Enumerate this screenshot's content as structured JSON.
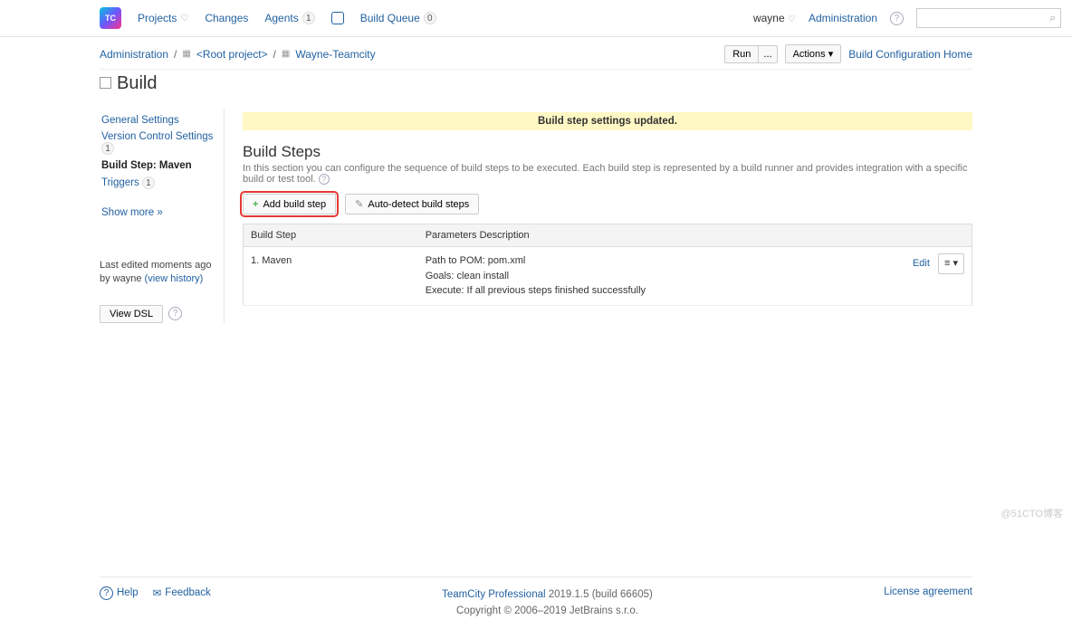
{
  "topnav": {
    "projects": "Projects",
    "changes": "Changes",
    "agents": "Agents",
    "agents_count": "1",
    "build_queue": "Build Queue",
    "queue_count": "0",
    "user": "wayne",
    "admin": "Administration",
    "search_placeholder": ""
  },
  "breadcrumb": {
    "admin": "Administration",
    "root": "<Root project>",
    "project": "Wayne-Teamcity"
  },
  "toolbar": {
    "run": "Run",
    "ellipsis": "...",
    "actions": "Actions ▾",
    "config_home": "Build Configuration Home"
  },
  "title": "Build",
  "sidebar": {
    "items": [
      {
        "label": "General Settings"
      },
      {
        "label": "Version Control Settings",
        "count": "1"
      },
      {
        "label": "Build Step: Maven"
      },
      {
        "label": "Triggers",
        "count": "1"
      }
    ],
    "more": "Show more »",
    "edited_prefix": "Last edited",
    "edited_when": "moments ago",
    "edited_by": "by wayne  ",
    "history": "(view history)",
    "view_dsl": "View DSL"
  },
  "notice": "Build step settings updated.",
  "section": {
    "heading": "Build Steps",
    "desc": "In this section you can configure the sequence of build steps to be executed. Each build step is represented by a build runner and provides integration with a specific build or test tool."
  },
  "buttons": {
    "add": "Add build step",
    "auto": "Auto-detect build steps"
  },
  "table": {
    "col1": "Build Step",
    "col2": "Parameters Description",
    "rows": [
      {
        "step": "1. Maven",
        "params": "Path to POM: pom.xml\nGoals: clean install\nExecute: If all previous steps finished successfully",
        "edit": "Edit"
      }
    ]
  },
  "footer": {
    "help": "Help",
    "feedback": "Feedback",
    "product": "TeamCity Professional",
    "version": "2019.1.5 (build 66605)",
    "copyright": "Copyright © 2006–2019 JetBrains s.r.o.",
    "license": "License agreement"
  },
  "watermark": "@51CTO博客"
}
